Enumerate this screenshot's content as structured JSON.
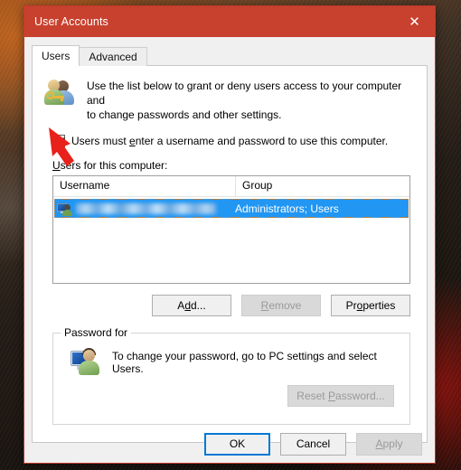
{
  "window": {
    "title": "User Accounts",
    "close_icon": "close-icon",
    "accent_color": "#c8412e"
  },
  "tabs": [
    {
      "label": "Users",
      "active": true
    },
    {
      "label": "Advanced",
      "active": false
    }
  ],
  "description": {
    "icon": "users-key-icon",
    "line1": "Use the list below to grant or deny users access to your computer and",
    "line2": "to change passwords and other settings.",
    "full": "Use the list below to grant or deny users access to your computer and to change passwords and other settings."
  },
  "require_password_checkbox": {
    "checked": true,
    "label_before": "Users must ",
    "accelerator": "e",
    "label_after": "nter a username and password to use this computer."
  },
  "users_list": {
    "label_accelerator": "U",
    "label_rest": "sers for this computer:",
    "columns": [
      "Username",
      "Group"
    ],
    "rows": [
      {
        "icon": "list-user-icon",
        "username": "",
        "username_redacted": true,
        "group": "Administrators; Users",
        "selected": true
      }
    ]
  },
  "list_buttons": [
    {
      "label_before": "A",
      "accelerator": "d",
      "label_after": "d...",
      "name": "add-button",
      "disabled": false
    },
    {
      "label_before": "",
      "accelerator": "R",
      "label_after": "emove",
      "name": "remove-button",
      "disabled": true
    },
    {
      "label_before": "Pr",
      "accelerator": "o",
      "label_after": "perties",
      "name": "properties-button",
      "disabled": false
    }
  ],
  "password_group": {
    "title": "Password for",
    "icon": "pc-user-icon",
    "text": "To change your password, go to PC settings and select Users.",
    "reset_button": {
      "label_before": "Reset ",
      "accelerator": "P",
      "label_after": "assword...",
      "disabled": true
    }
  },
  "dialog_buttons": [
    {
      "label": "OK",
      "name": "ok-button",
      "default": true,
      "disabled": false
    },
    {
      "label": "Cancel",
      "name": "cancel-button",
      "default": false,
      "disabled": false
    },
    {
      "label_before": "",
      "accelerator": "A",
      "label_after": "pply",
      "name": "apply-button",
      "default": false,
      "disabled": true
    }
  ],
  "annotation": {
    "type": "red-arrow",
    "color": "#e8211b",
    "points_to": "require-password-checkbox"
  }
}
